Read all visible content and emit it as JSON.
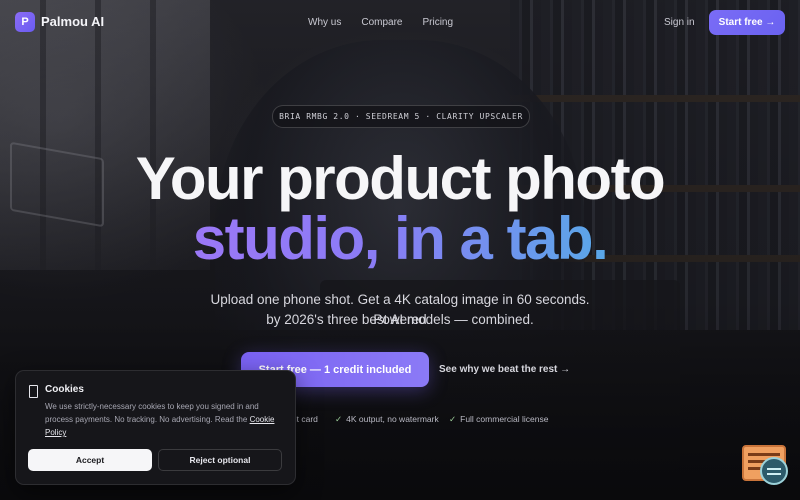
{
  "nav": {
    "logo_letter": "P",
    "brand": "Palmou AI",
    "links": [
      "Why us",
      "Compare",
      "Pricing"
    ],
    "signin": "Sign in",
    "cta": "Start free →"
  },
  "hero": {
    "badge": "BRIA RMBG 2.0 · SEEDREAM 5 · CLARITY UPSCALER",
    "headline_line1": "Your product photo",
    "headline_line2": "studio, in a tab.",
    "subhead_line1": "Upload one phone shot. Get a 4K catalog image in 60 seconds. Powered",
    "subhead_line2": "by 2026's three best AI models — combined.",
    "primary_cta": "Start free — 1 credit included",
    "secondary_cta": "See why we beat the rest →",
    "trust": [
      "dit card",
      "4K output, no watermark",
      "Full commercial license"
    ],
    "check_glyph": "✓"
  },
  "cookie": {
    "title": "Cookies",
    "body": "We use strictly-necessary cookies to keep you signed in and process payments. No tracking. No advertising. Read the",
    "policy_link": "Cookie Policy",
    "accept": "Accept",
    "reject": "Reject optional"
  },
  "colors": {
    "accent": "#7a6cf6",
    "gradient_start": "#9b78f7",
    "gradient_end": "#59a8e8",
    "background": "#141418"
  },
  "icons": {
    "cookie": "cookie-icon",
    "widget": "chat-widget-icon"
  }
}
